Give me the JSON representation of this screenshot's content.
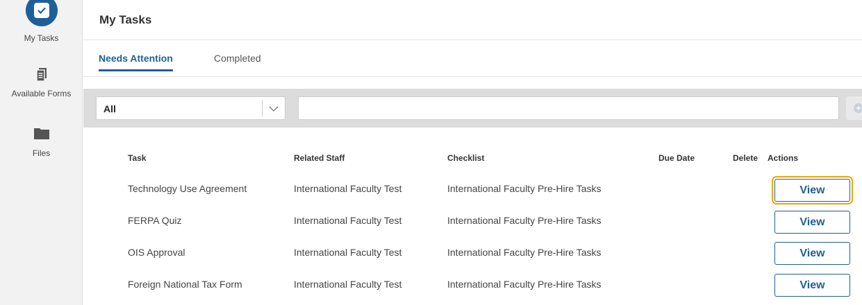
{
  "sidebar": {
    "items": [
      {
        "label": "My Tasks",
        "icon": "checkbox-icon"
      },
      {
        "label": "Available Forms",
        "icon": "document-icon"
      },
      {
        "label": "Files",
        "icon": "folder-icon"
      }
    ]
  },
  "header": {
    "title": "My Tasks"
  },
  "tabs": [
    {
      "label": "Needs Attention",
      "active": true
    },
    {
      "label": "Completed",
      "active": false
    }
  ],
  "filter": {
    "selected": "All",
    "search_value": "",
    "add_icon": "plus-circle-icon"
  },
  "table": {
    "headers": {
      "task": "Task",
      "related_staff": "Related Staff",
      "checklist": "Checklist",
      "due_date": "Due Date",
      "delete": "Delete",
      "actions": "Actions"
    },
    "rows": [
      {
        "task": "Technology Use Agreement",
        "related_staff": "International Faculty Test",
        "checklist": "International Faculty Pre-Hire Tasks",
        "due_date": "",
        "action": "View"
      },
      {
        "task": "FERPA Quiz",
        "related_staff": "International Faculty Test",
        "checklist": "International Faculty Pre-Hire Tasks",
        "due_date": "",
        "action": "View"
      },
      {
        "task": "OIS Approval",
        "related_staff": "International Faculty Test",
        "checklist": "International Faculty Pre-Hire Tasks",
        "due_date": "",
        "action": "View"
      },
      {
        "task": "Foreign National Tax Form",
        "related_staff": "International Faculty Test",
        "checklist": "International Faculty Pre-Hire Tasks",
        "due_date": "",
        "action": "View"
      }
    ]
  },
  "colors": {
    "accent": "#1f5f99",
    "focus_outline": "#f0a500",
    "sidebar_bg": "#f2f2f2",
    "filter_bar_bg": "#dcdcdc"
  }
}
